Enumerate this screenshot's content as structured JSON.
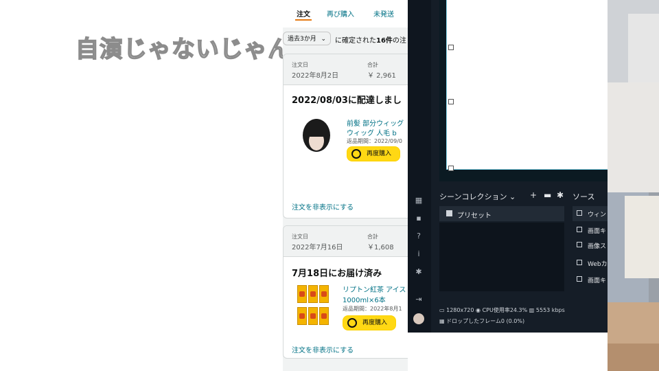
{
  "caption": "自演じゃないじゃん",
  "amazon": {
    "tabs": [
      "注文",
      "再び購入",
      "未発送"
    ],
    "filter_value": "過去3か月",
    "filter_text_prefix": "に確定された",
    "filter_text_count": "16件",
    "filter_text_suffix": "の注",
    "orders": [
      {
        "date_label": "注文日",
        "date": "2022年8月2日",
        "total_label": "合計",
        "total": "￥ 2,961",
        "status": "2022/08/03に配達しまし",
        "item_title_1": "前髪 部分ウィッグ",
        "item_title_2": "ウィッグ 人毛 b",
        "return_text": "返品期間：2022/09/0",
        "buy_again": "再度購入",
        "hide": "注文を非表示にする"
      },
      {
        "date_label": "注文日",
        "date": "2022年7月16日",
        "total_label": "合計",
        "total": "￥1,608",
        "status": "7月18日にお届け済み",
        "item_title_1": "リプトン紅茶 アイス",
        "item_title_2": "1000ml×6本",
        "return_text": "返品期間：2022年8月1",
        "buy_again": "再度購入",
        "hide": "注文を非表示にする"
      }
    ]
  },
  "obs": {
    "scene_collection": "シーンコレクション",
    "sources_title": "ソース",
    "scene_item": "プリセット",
    "sources": [
      "ウィン",
      "画面キ",
      "画像ス",
      "Webカ",
      "画面キ"
    ],
    "resolution": "1280x720",
    "cpu": "CPU使用率24.3%",
    "bitrate": "5553 kbps",
    "dropped": "ドロップしたフレーム0 (0.0%)"
  },
  "colors": {
    "accent_orange": "#e47911",
    "link_teal": "#007185",
    "buy_yellow": "#ffd814",
    "obs_bg": "#151d27"
  }
}
